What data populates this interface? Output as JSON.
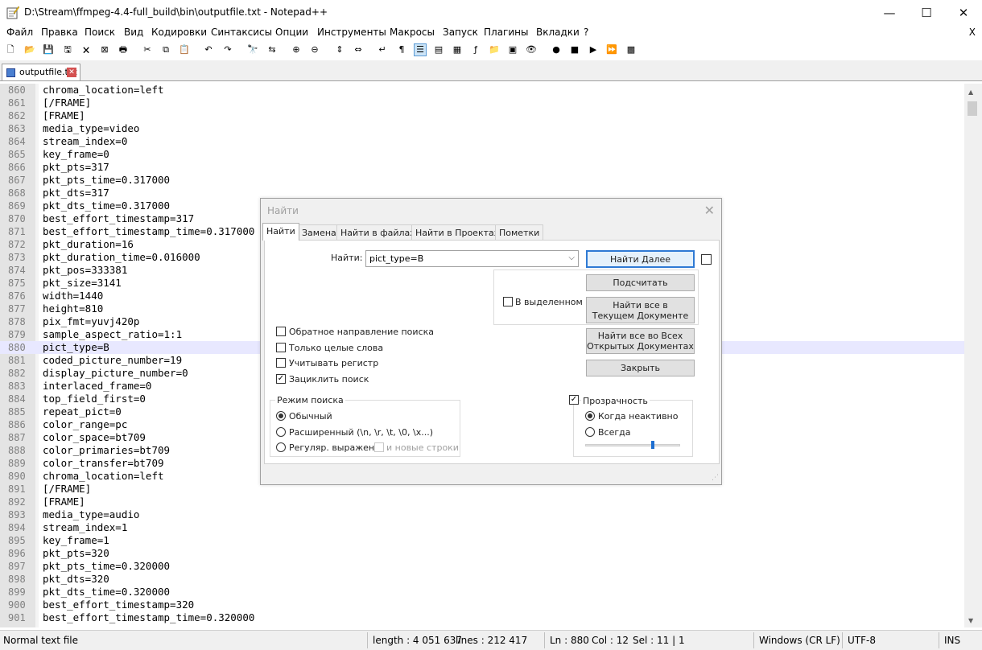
{
  "window": {
    "title": "D:\\Stream\\ffmpeg-4.4-full_build\\bin\\outputfile.txt - Notepad++",
    "minimize": "—",
    "maximize": "☐",
    "close": "✕"
  },
  "menu": {
    "items": [
      "Файл",
      "Правка",
      "Поиск",
      "Вид",
      "Кодировки",
      "Синтаксисы",
      "Опции",
      "Инструменты",
      "Макросы",
      "Запуск",
      "Плагины",
      "Вкладки",
      "?"
    ],
    "close": "X"
  },
  "toolbar": {
    "icons": [
      "new-file-icon",
      "open-file-icon",
      "save-icon",
      "save-all-icon",
      "close-icon",
      "close-all-icon",
      "print-icon",
      "cut-icon",
      "copy-icon",
      "paste-icon",
      "undo-icon",
      "redo-icon",
      "find-icon",
      "replace-icon",
      "zoom-in-icon",
      "zoom-out-icon",
      "sync-vertical-icon",
      "sync-horizontal-icon",
      "word-wrap-icon",
      "show-all-chars-icon",
      "indent-guide-icon",
      "udl-icon",
      "doc-map-icon",
      "function-list-icon",
      "folder-workspace-icon",
      "document-list-icon",
      "monitoring-icon",
      "record-macro-icon",
      "stop-record-icon",
      "play-macro-icon",
      "run-multiple-macro-icon",
      "save-macro-icon"
    ],
    "glyphs": [
      "🗋",
      "📂",
      "💾",
      "🖫",
      "🗙",
      "⊠",
      "🖶",
      "✂",
      "⧉",
      "📋",
      "↶",
      "↷",
      "🔭",
      "⇆",
      "⊕",
      "⊖",
      "⇕",
      "⇔",
      "↵",
      "¶",
      "☰",
      "▤",
      "▦",
      "ƒ",
      "📁",
      "▣",
      "👁",
      "●",
      "■",
      "▶",
      "⏩",
      "▩"
    ]
  },
  "tab": {
    "label": "outputfile.txt",
    "close": "✕"
  },
  "editor": {
    "current_line": 880,
    "lines": [
      {
        "n": "860",
        "t": "chroma_location=left"
      },
      {
        "n": "861",
        "t": "[/FRAME]"
      },
      {
        "n": "862",
        "t": "[FRAME]"
      },
      {
        "n": "863",
        "t": "media_type=video"
      },
      {
        "n": "864",
        "t": "stream_index=0"
      },
      {
        "n": "865",
        "t": "key_frame=0"
      },
      {
        "n": "866",
        "t": "pkt_pts=317"
      },
      {
        "n": "867",
        "t": "pkt_pts_time=0.317000"
      },
      {
        "n": "868",
        "t": "pkt_dts=317"
      },
      {
        "n": "869",
        "t": "pkt_dts_time=0.317000"
      },
      {
        "n": "870",
        "t": "best_effort_timestamp=317"
      },
      {
        "n": "871",
        "t": "best_effort_timestamp_time=0.317000"
      },
      {
        "n": "872",
        "t": "pkt_duration=16"
      },
      {
        "n": "873",
        "t": "pkt_duration_time=0.016000"
      },
      {
        "n": "874",
        "t": "pkt_pos=333381"
      },
      {
        "n": "875",
        "t": "pkt_size=3141"
      },
      {
        "n": "876",
        "t": "width=1440"
      },
      {
        "n": "877",
        "t": "height=810"
      },
      {
        "n": "878",
        "t": "pix_fmt=yuvj420p"
      },
      {
        "n": "879",
        "t": "sample_aspect_ratio=1:1"
      },
      {
        "n": "880",
        "t": "pict_type=B"
      },
      {
        "n": "881",
        "t": "coded_picture_number=19"
      },
      {
        "n": "882",
        "t": "display_picture_number=0"
      },
      {
        "n": "883",
        "t": "interlaced_frame=0"
      },
      {
        "n": "884",
        "t": "top_field_first=0"
      },
      {
        "n": "885",
        "t": "repeat_pict=0"
      },
      {
        "n": "886",
        "t": "color_range=pc"
      },
      {
        "n": "887",
        "t": "color_space=bt709"
      },
      {
        "n": "888",
        "t": "color_primaries=bt709"
      },
      {
        "n": "889",
        "t": "color_transfer=bt709"
      },
      {
        "n": "890",
        "t": "chroma_location=left"
      },
      {
        "n": "891",
        "t": "[/FRAME]"
      },
      {
        "n": "892",
        "t": "[FRAME]"
      },
      {
        "n": "893",
        "t": "media_type=audio"
      },
      {
        "n": "894",
        "t": "stream_index=1"
      },
      {
        "n": "895",
        "t": "key_frame=1"
      },
      {
        "n": "896",
        "t": "pkt_pts=320"
      },
      {
        "n": "897",
        "t": "pkt_pts_time=0.320000"
      },
      {
        "n": "898",
        "t": "pkt_dts=320"
      },
      {
        "n": "899",
        "t": "pkt_dts_time=0.320000"
      },
      {
        "n": "900",
        "t": "best_effort_timestamp=320"
      },
      {
        "n": "901",
        "t": "best_effort_timestamp_time=0.320000"
      }
    ]
  },
  "find_dialog": {
    "title": "Найти",
    "close": "✕",
    "tabs": [
      "Найти",
      "Замена",
      "Найти в файлах",
      "Найти в Проектах",
      "Пометки"
    ],
    "find_label": "Найти:",
    "find_value": "pict_type=B",
    "dropdown_arrow": "⌵",
    "buttons": {
      "find_next": "Найти Далее",
      "count": "Подсчитать",
      "find_all_current_1": "Найти все в",
      "find_all_current_2": "Текущем Документе",
      "find_all_open_1": "Найти все во Всех",
      "find_all_open_2": "Открытых Документах",
      "close": "Закрыть"
    },
    "in_selection": "В выделенном",
    "options": {
      "backward": "Обратное направление поиска",
      "whole_word": "Только целые слова",
      "match_case": "Учитывать регистр",
      "wrap_around": "Зациклить поиск"
    },
    "search_mode": {
      "title": "Режим поиска",
      "normal": "Обычный",
      "extended": "Расширенный (\\n, \\r, \\t, \\0, \\x...)",
      "regex": "Регуляр. выражен.",
      "newline": "и новые строки"
    },
    "transparency": {
      "title": "Прозрачность",
      "on_losing_focus": "Когда неактивно",
      "always": "Всегда"
    }
  },
  "status": {
    "file_type": "Normal text file",
    "length": "length : 4 051 637",
    "lines": "lines : 212 417",
    "ln": "Ln : 880",
    "col": "Col : 12",
    "sel": "Sel : 11 | 1",
    "eol": "Windows (CR LF)",
    "encoding": "UTF-8",
    "mode": "INS"
  }
}
